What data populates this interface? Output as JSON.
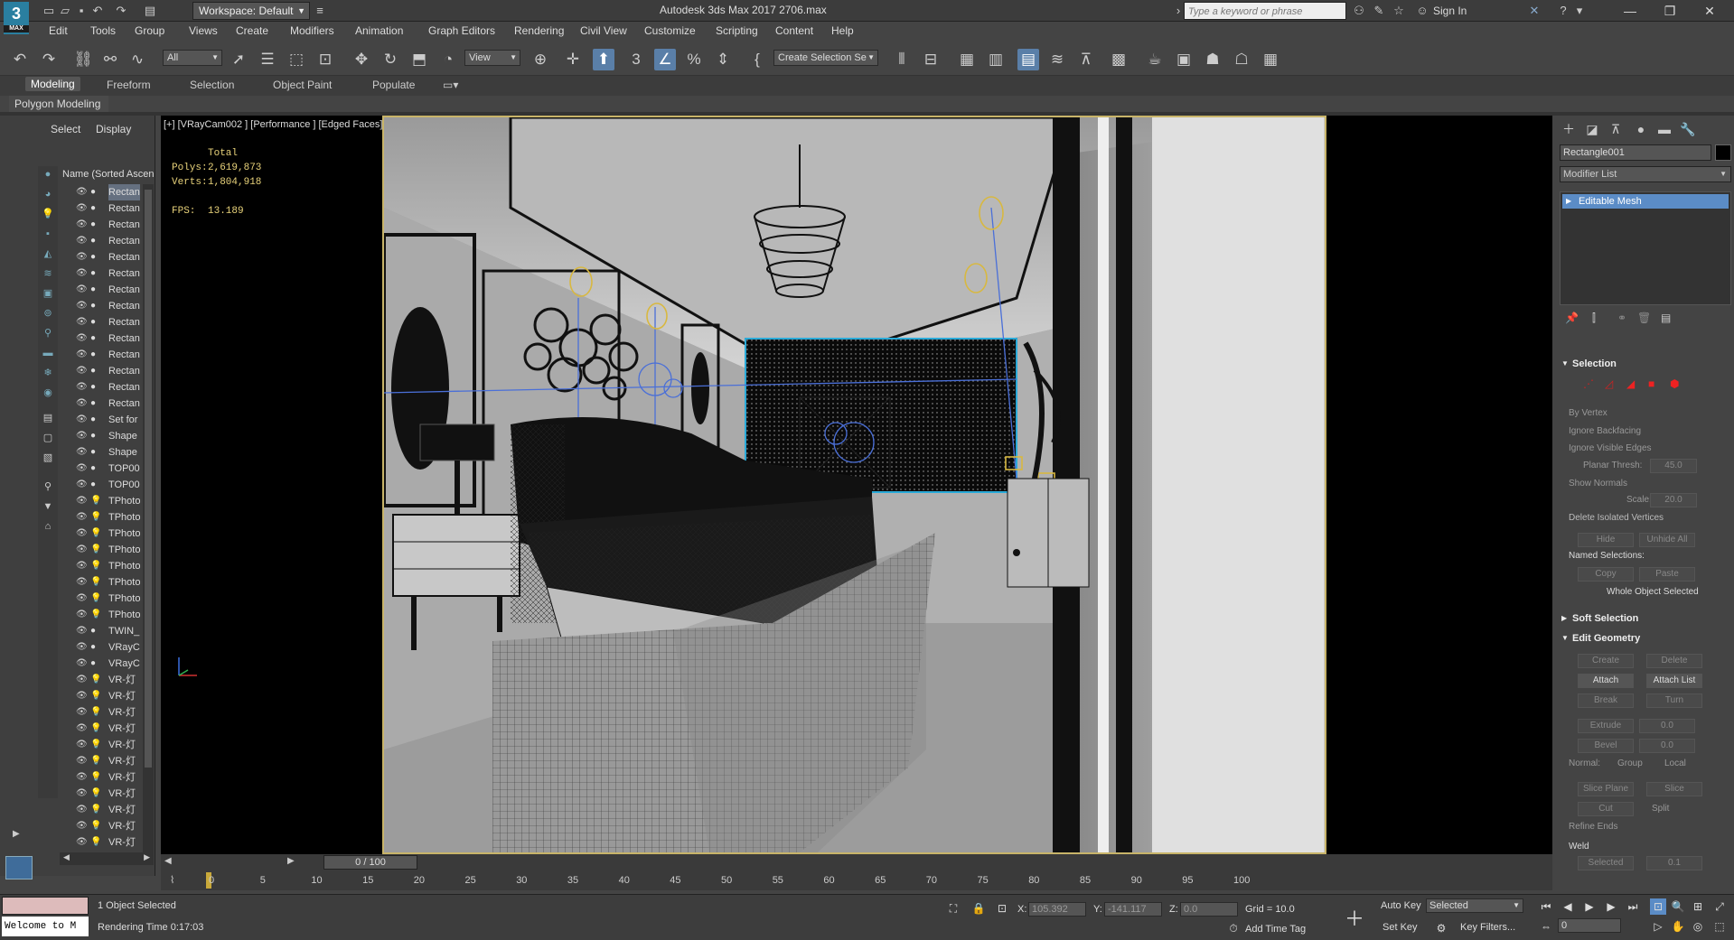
{
  "app": {
    "logo_text": "3",
    "logo_sub": "MAX",
    "title": "Autodesk 3ds Max 2017     2706.max",
    "workspace": "Workspace: Default",
    "search_placeholder": "Type a keyword or phrase",
    "sign_in": "Sign In"
  },
  "menu": [
    "Edit",
    "Tools",
    "Group",
    "Views",
    "Create",
    "Modifiers",
    "Animation",
    "Graph Editors",
    "Rendering",
    "Civil View",
    "Customize",
    "Scripting",
    "Content",
    "Help"
  ],
  "toolbar": {
    "filter": "All",
    "ref_coord": "View",
    "named_selection": "Create Selection Se"
  },
  "ribbon": {
    "tabs": [
      "Modeling",
      "Freeform",
      "Selection",
      "Object Paint",
      "Populate"
    ],
    "active": "Modeling",
    "panel_label": "Polygon Modeling"
  },
  "explorer": {
    "tabs": [
      "Select",
      "Display"
    ],
    "column_header": "Name (Sorted Ascen",
    "rows": [
      "Rectan",
      "Rectan",
      "Rectan",
      "Rectan",
      "Rectan",
      "Rectan",
      "Rectan",
      "Rectan",
      "Rectan",
      "Rectan",
      "Rectan",
      "Rectan",
      "Rectan",
      "Rectan",
      "Set for",
      "Shape",
      "Shape",
      "TOP00",
      "TOP00",
      "TPhoto",
      "TPhoto",
      "TPhoto",
      "TPhoto",
      "TPhoto",
      "TPhoto",
      "TPhoto",
      "TPhoto",
      "TWIN_",
      "VRayC",
      "VRayC",
      "VR-灯",
      "VR-灯",
      "VR-灯",
      "VR-灯",
      "VR-灯",
      "VR-灯",
      "VR-灯",
      "VR-灯",
      "VR-灯",
      "VR-灯",
      "VR-灯"
    ]
  },
  "viewport": {
    "label": "[+] [VRayCam002 ] [Performance ] [Edged Faces]",
    "stats_total": "Total",
    "polys_label": "Polys:",
    "polys": "2,619,873",
    "verts_label": "Verts:",
    "verts": "1,804,918",
    "fps_label": "FPS:",
    "fps": "13.189"
  },
  "command_panel": {
    "object_name": "Rectangle001",
    "modifier_list": "Modifier List",
    "stack_item": "Editable Mesh",
    "selection": {
      "title": "Selection",
      "by_vertex": "By Vertex",
      "ignore_backfacing": "Ignore Backfacing",
      "ignore_visible_edges": "Ignore Visible Edges",
      "planar_thresh": "Planar Thresh:",
      "planar_value": "45.0",
      "show_normals": "Show Normals",
      "scale_label": "Scale:",
      "scale_value": "20.0",
      "delete_isolated": "Delete Isolated Vertices",
      "hide": "Hide",
      "unhide_all": "Unhide All",
      "named_selections": "Named Selections:",
      "copy": "Copy",
      "paste": "Paste",
      "whole_object": "Whole Object Selected"
    },
    "soft_selection": "Soft Selection",
    "edit_geometry": {
      "title": "Edit Geometry",
      "create": "Create",
      "delete": "Delete",
      "attach": "Attach",
      "attach_list": "Attach List",
      "break": "Break",
      "turn": "Turn",
      "extrude": "Extrude",
      "extrude_value": "0.0",
      "bevel": "Bevel",
      "bevel_value": "0.0",
      "normal_label": "Normal:",
      "group": "Group",
      "local": "Local",
      "slice_plane": "Slice Plane",
      "slice": "Slice",
      "cut": "Cut",
      "split": "Split",
      "refine_ends": "Refine Ends",
      "weld": "Weld",
      "selected": "Selected",
      "weld_value": "0.1"
    }
  },
  "timeline": {
    "frame_box": "0 / 100",
    "ticks": [
      "0",
      "5",
      "10",
      "15",
      "20",
      "25",
      "30",
      "35",
      "40",
      "45",
      "50",
      "55",
      "60",
      "65",
      "70",
      "75",
      "80",
      "85",
      "90",
      "95",
      "100"
    ]
  },
  "status": {
    "maxscript_text": "Welcome to M",
    "objects_selected": "1 Object Selected",
    "rendering_time": "Rendering Time  0:17:03",
    "x_label": "X:",
    "x_value": "105.392",
    "y_label": "Y:",
    "y_value": "-141.117",
    "z_label": "Z:",
    "z_value": "0.0",
    "grid": "Grid = 10.0",
    "add_time_tag": "Add Time Tag",
    "auto_key": "Auto Key",
    "set_key": "Set Key",
    "selected_dropdown": "Selected",
    "key_filters": "Key Filters...",
    "frame_value": "0"
  },
  "colors": {
    "selection_accent": "#5b8cc6",
    "viewport_border": "#c8b469",
    "stats_text": "#e8d27a"
  }
}
